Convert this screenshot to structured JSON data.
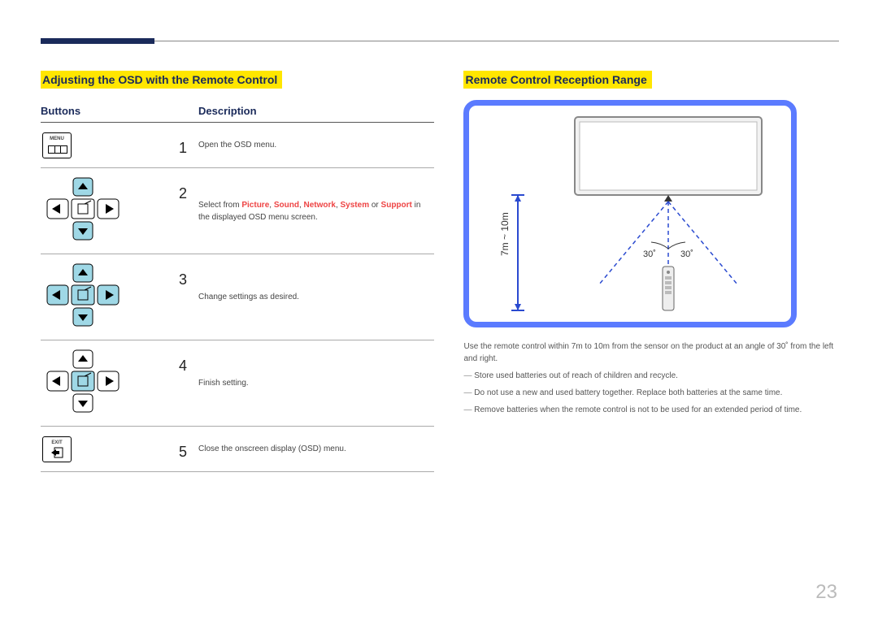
{
  "page_number": "23",
  "left": {
    "heading": "Adjusting the OSD with the Remote Control",
    "col_buttons": "Buttons",
    "col_description": "Description",
    "rows": [
      {
        "num": "1",
        "desc_plain": "Open the OSD menu."
      },
      {
        "num": "2",
        "desc_prefix": "Select from ",
        "h1": "Picture",
        "h2": "Sound",
        "h3": "Network",
        "h4": "System",
        "mid": " or ",
        "h5": "Support",
        "suffix": " in the displayed OSD menu screen."
      },
      {
        "num": "3",
        "desc_plain": "Change settings as desired."
      },
      {
        "num": "4",
        "desc_plain": "Finish setting."
      },
      {
        "num": "5",
        "desc_plain": "Close the onscreen display (OSD) menu."
      }
    ],
    "menu_label": "MENU",
    "exit_label": "EXIT"
  },
  "right": {
    "heading": "Remote Control Reception Range",
    "distance_label": "7m ~ 10m",
    "angle_left": "30˚",
    "angle_right": "30˚",
    "usage_note": "Use the remote control within 7m to 10m from the sensor on the product at an angle of 30˚ from the left and right.",
    "bullet1": "Store used batteries out of reach of children and recycle.",
    "bullet2": "Do not use a new and used battery together. Replace both batteries at the same time.",
    "bullet3": "Remove batteries when the remote control is not to be used for an extended period of time."
  }
}
